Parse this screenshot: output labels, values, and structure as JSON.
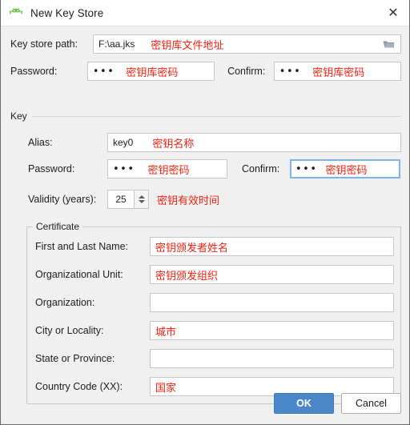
{
  "window": {
    "title": "New Key Store",
    "icon": "android-robot-icon",
    "close_label": "✕"
  },
  "keystore": {
    "path_label": "Key store path:",
    "path_value": "F:\\aa.jks",
    "path_hint": "密钥库文件地址",
    "browse_icon": "folder-icon",
    "password_label": "Password:",
    "password_value": "•••",
    "password_hint": "密钥库密码",
    "confirm_label": "Confirm:",
    "confirm_value": "•••",
    "confirm_hint": "密钥库密码"
  },
  "key": {
    "group_label": "Key",
    "alias_label": "Alias:",
    "alias_value": "key0",
    "alias_hint": "密钥名称",
    "password_label": "Password:",
    "password_value": "•••",
    "password_hint": "密钥密码",
    "confirm_label": "Confirm:",
    "confirm_value": "•••",
    "confirm_hint": "密钥密码",
    "validity_label": "Validity (years):",
    "validity_value": "25",
    "validity_hint": "密钥有效时间"
  },
  "certificate": {
    "group_label": "Certificate",
    "fields": [
      {
        "label": "First and Last Name:",
        "value": "",
        "hint": "密钥颁发者姓名"
      },
      {
        "label": "Organizational Unit:",
        "value": "",
        "hint": "密钥颁发组织"
      },
      {
        "label": "Organization:",
        "value": "",
        "hint": ""
      },
      {
        "label": "City or Locality:",
        "value": "",
        "hint": "城市"
      },
      {
        "label": "State or Province:",
        "value": "",
        "hint": ""
      },
      {
        "label": "Country Code (XX):",
        "value": "",
        "hint": "国家"
      }
    ]
  },
  "buttons": {
    "ok_label": "OK",
    "cancel_label": "Cancel"
  },
  "colors": {
    "accent": "#4a86c8",
    "hint_red": "#ee2211",
    "focus_border": "#7eb4ea",
    "dialog_bg": "#f0f0f0"
  }
}
